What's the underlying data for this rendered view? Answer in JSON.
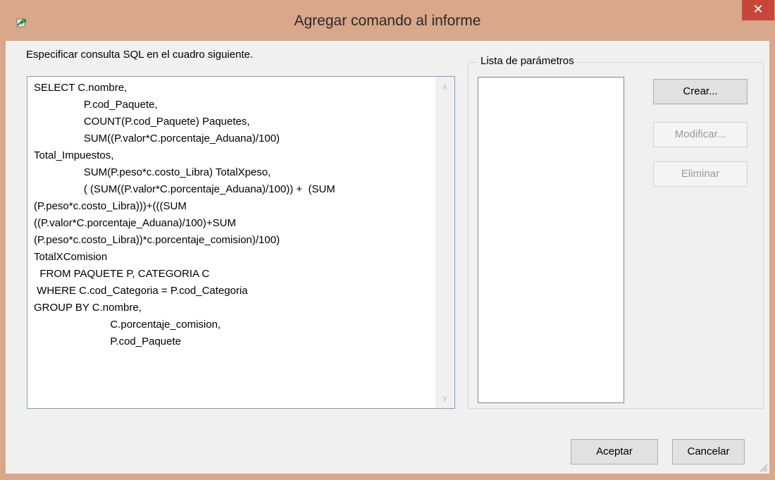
{
  "window": {
    "title": "Agregar comando al informe",
    "close_glyph": "✕",
    "icon": "app-icon"
  },
  "instruction": "Especificar consulta SQL en el cuadro siguiente.",
  "sql_query": "SELECT C.nombre,\n                 P.cod_Paquete,\n                 COUNT(P.cod_Paquete) Paquetes,\n                 SUM((P.valor*C.porcentaje_Aduana)/100)\nTotal_Impuestos,\n                 SUM(P.peso*c.costo_Libra) TotalXpeso,\n                 ( (SUM((P.valor*C.porcentaje_Aduana)/100)) +  (SUM\n(P.peso*c.costo_Libra)))+(((SUM\n((P.valor*C.porcentaje_Aduana)/100)+SUM\n(P.peso*c.costo_Libra))*c.porcentaje_comision)/100)\nTotalXComision\n  FROM PAQUETE P, CATEGORIA C\n WHERE C.cod_Categoria = P.cod_Categoria\nGROUP BY C.nombre,\n                          C.porcentaje_comision,\n                          P.cod_Paquete",
  "scrollbar": {
    "up_glyph": "∧",
    "down_glyph": "∨"
  },
  "parameters": {
    "legend": "Lista de parámetros",
    "items": [],
    "create_label": "Crear...",
    "modify_label": "Modificar...",
    "delete_label": "Eliminar"
  },
  "footer": {
    "accept_label": "Aceptar",
    "cancel_label": "Cancelar"
  },
  "colors": {
    "titlebar": "#d9a78a",
    "close_button": "#c7463a",
    "client_background": "#f0f0f0",
    "disabled_text": "#9a9a9a"
  }
}
